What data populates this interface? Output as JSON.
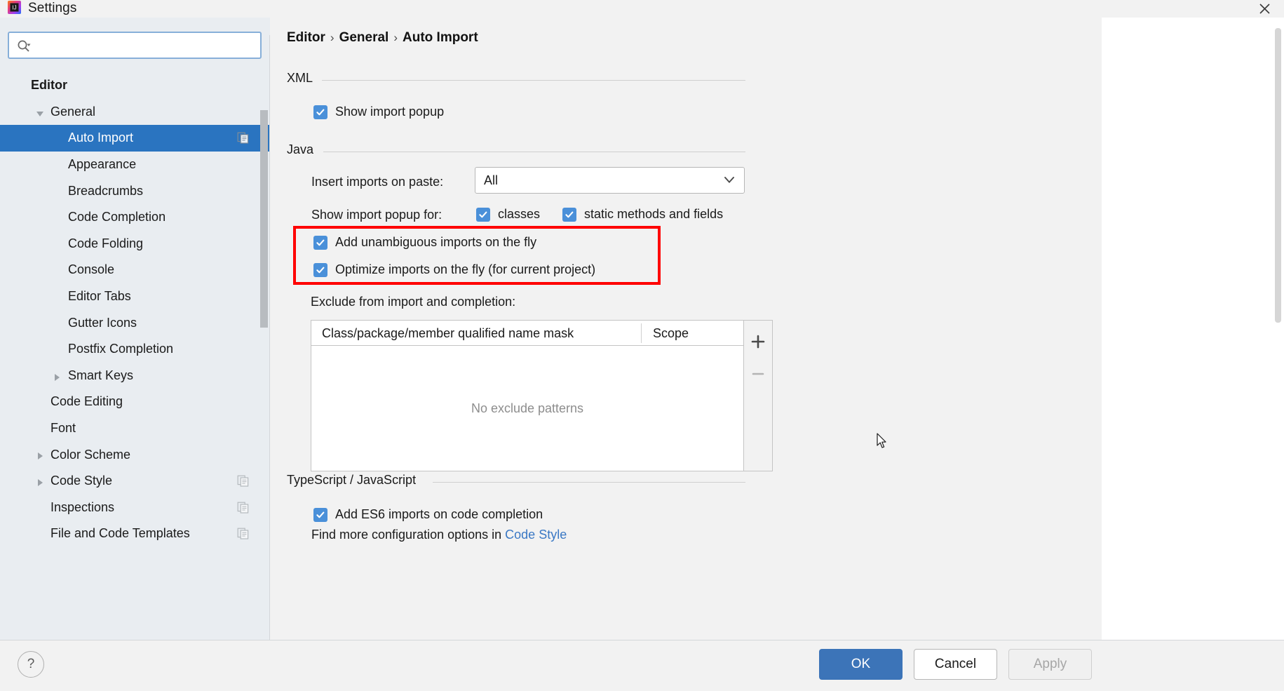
{
  "window": {
    "title": "Settings",
    "app_icon": "intellij-idea-icon",
    "close_icon": "close-icon"
  },
  "search": {
    "placeholder": "",
    "value": "",
    "icon": "search-icon"
  },
  "sidebar": {
    "items": [
      {
        "label": "Editor",
        "level": 0,
        "twisty": "none",
        "selected": false,
        "copy_icon": false
      },
      {
        "label": "General",
        "level": 1,
        "twisty": "expanded",
        "selected": false,
        "copy_icon": false
      },
      {
        "label": "Auto Import",
        "level": 2,
        "twisty": "none",
        "selected": true,
        "copy_icon": true
      },
      {
        "label": "Appearance",
        "level": 2,
        "twisty": "none",
        "selected": false,
        "copy_icon": false
      },
      {
        "label": "Breadcrumbs",
        "level": 2,
        "twisty": "none",
        "selected": false,
        "copy_icon": false
      },
      {
        "label": "Code Completion",
        "level": 2,
        "twisty": "none",
        "selected": false,
        "copy_icon": false
      },
      {
        "label": "Code Folding",
        "level": 2,
        "twisty": "none",
        "selected": false,
        "copy_icon": false
      },
      {
        "label": "Console",
        "level": 2,
        "twisty": "none",
        "selected": false,
        "copy_icon": false
      },
      {
        "label": "Editor Tabs",
        "level": 2,
        "twisty": "none",
        "selected": false,
        "copy_icon": false
      },
      {
        "label": "Gutter Icons",
        "level": 2,
        "twisty": "none",
        "selected": false,
        "copy_icon": false
      },
      {
        "label": "Postfix Completion",
        "level": 2,
        "twisty": "none",
        "selected": false,
        "copy_icon": false
      },
      {
        "label": "Smart Keys",
        "level": 2,
        "twisty": "collapsed",
        "selected": false,
        "copy_icon": false
      },
      {
        "label": "Code Editing",
        "level": 1,
        "twisty": "none",
        "selected": false,
        "copy_icon": false
      },
      {
        "label": "Font",
        "level": 1,
        "twisty": "none",
        "selected": false,
        "copy_icon": false
      },
      {
        "label": "Color Scheme",
        "level": 1,
        "twisty": "collapsed",
        "selected": false,
        "copy_icon": false
      },
      {
        "label": "Code Style",
        "level": 1,
        "twisty": "collapsed",
        "selected": false,
        "copy_icon": true
      },
      {
        "label": "Inspections",
        "level": 1,
        "twisty": "none",
        "selected": false,
        "copy_icon": true
      },
      {
        "label": "File and Code Templates",
        "level": 1,
        "twisty": "none",
        "selected": false,
        "copy_icon": true
      }
    ]
  },
  "breadcrumb": {
    "part1": "Editor",
    "sep1": "›",
    "part2": "General",
    "sep2": "›",
    "part3": "Auto Import"
  },
  "sections": {
    "xml": {
      "title": "XML",
      "show_import_popup": {
        "label": "Show import popup",
        "checked": true
      }
    },
    "java": {
      "title": "Java",
      "insert_imports_label": "Insert imports on paste:",
      "insert_imports_value": "All",
      "show_import_popup_for_label": "Show import popup for:",
      "classes": {
        "label": "classes",
        "checked": true
      },
      "static_methods": {
        "label": "static methods and fields",
        "checked": true
      },
      "add_unambiguous": {
        "label": "Add unambiguous imports on the fly",
        "checked": true
      },
      "optimize_imports": {
        "label": "Optimize imports on the fly (for current project)",
        "checked": true
      },
      "exclude_label": "Exclude from import and completion:",
      "table": {
        "columns": [
          "Class/package/member qualified name mask",
          "Scope"
        ],
        "rows": [],
        "empty_text": "No exclude patterns",
        "add_button": "+",
        "remove_button": "−"
      }
    },
    "typescript": {
      "title": "TypeScript / JavaScript",
      "add_es6": {
        "label": "Add ES6 imports on code completion",
        "checked": true
      },
      "hint_prefix": "Find more configuration options in ",
      "hint_link": "Code Style"
    }
  },
  "footer": {
    "help_label": "?",
    "ok_label": "OK",
    "cancel_label": "Cancel",
    "apply_label": "Apply"
  },
  "annotation": {
    "color": "#ff0000"
  },
  "colors": {
    "accent": "#2a74c0",
    "checkbox": "#4a90d9",
    "ok_button": "#3c74b8",
    "sidebar_bg": "#e9edf1",
    "content_bg": "#f2f2f2",
    "link": "#3a78c4"
  }
}
